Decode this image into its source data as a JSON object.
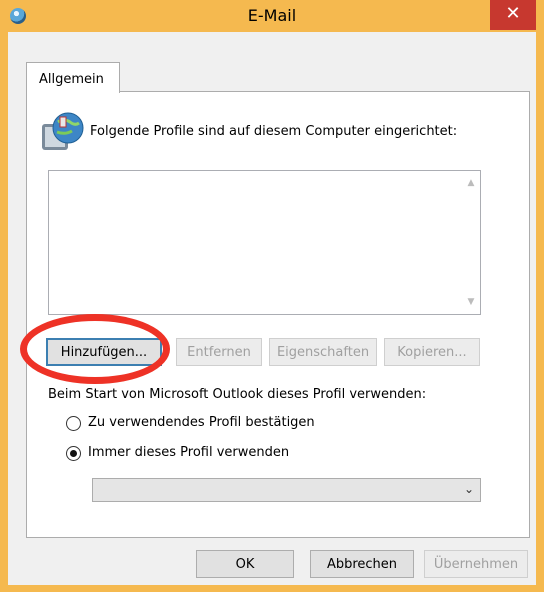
{
  "window": {
    "title": "E-Mail",
    "close_glyph": "✕"
  },
  "tabs": [
    {
      "label": "Allgemein"
    }
  ],
  "panel": {
    "heading": "Folgende Profile sind auf diesem Computer eingerichtet:",
    "profile_list": [],
    "buttons": {
      "add": "Hinzufügen...",
      "remove": "Entfernen",
      "properties": "Eigenschaften",
      "copy": "Kopieren..."
    },
    "startup_label": "Beim Start von Microsoft Outlook dieses Profil verwenden:",
    "radio_options": [
      {
        "label": "Zu verwendendes Profil bestätigen",
        "checked": false
      },
      {
        "label": "Immer dieses Profil verwenden",
        "checked": true
      }
    ],
    "profile_select": {
      "value": ""
    }
  },
  "footer": {
    "ok": "OK",
    "cancel": "Abbrechen",
    "apply": "Übernehmen"
  },
  "icons": {
    "scroll_up": "▲",
    "scroll_down": "▼",
    "dropdown": "⌄"
  },
  "colors": {
    "title_bar": "#f5b94f",
    "close_button": "#c7382f",
    "annotation_ring": "#ee3226"
  }
}
